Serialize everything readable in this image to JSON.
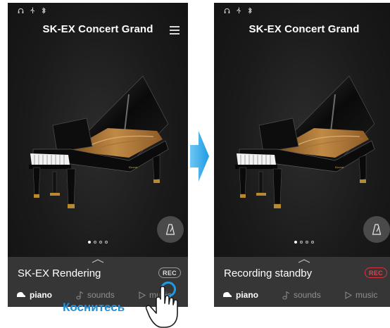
{
  "left_screen": {
    "title": "SK-EX Concert Grand",
    "status_text": "SK-EX Rendering",
    "rec_label": "REC",
    "nav": {
      "piano": "piano",
      "sounds": "sounds",
      "music": "music"
    }
  },
  "right_screen": {
    "title": "SK-EX Concert Grand",
    "status_text": "Recording standby",
    "rec_label": "REC",
    "nav": {
      "piano": "piano",
      "sounds": "sounds",
      "music": "music"
    }
  },
  "annotation": {
    "touch_label": "Коснитесь"
  },
  "icons": [
    "headphones-icon",
    "usb-icon",
    "bluetooth-icon",
    "menu-icon",
    "metronome-icon",
    "piano-icon",
    "note-icon",
    "play-icon",
    "arrow-right-icon",
    "hand-pointer-icon"
  ],
  "colors": {
    "rec_active": "#e0434d",
    "accent": "#1e9be6",
    "screen_bg": "#191919",
    "panel_bg": "#363636"
  }
}
